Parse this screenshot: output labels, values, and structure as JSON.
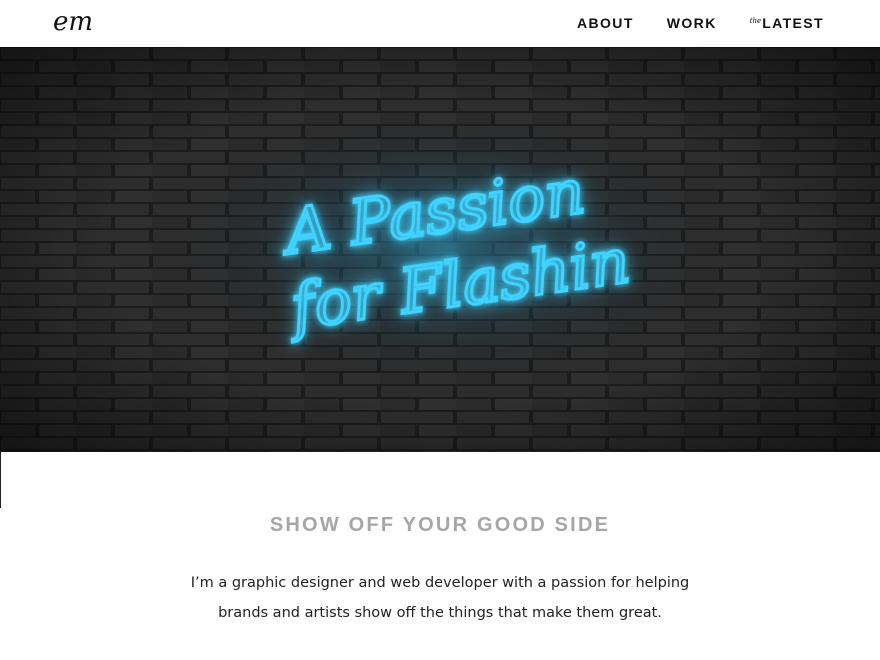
{
  "header": {
    "logo_text": "em",
    "logo_icon": "em-script-logo-icon",
    "nav": {
      "about": "ABOUT",
      "work": "WORK",
      "latest_prefix": "the",
      "latest": "LATEST"
    }
  },
  "hero": {
    "neon_line_1": "A Passion",
    "neon_line_2": "for Flashin",
    "neon_color": "#3fd3ff",
    "wall_color": "#151515"
  },
  "content": {
    "headline": "SHOW OFF YOUR GOOD SIDE",
    "intro": "I’m a graphic designer and web developer with a passion for helping brands and artists show off the things that make them great."
  }
}
